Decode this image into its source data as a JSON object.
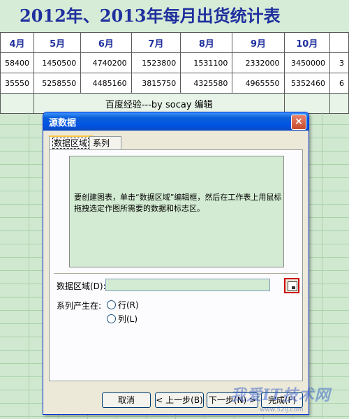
{
  "sheet": {
    "title": "2012年、2013年每月出货统计表",
    "columns": [
      "4月",
      "5月",
      "6月",
      "7月",
      "8月",
      "9月",
      "10月",
      ""
    ],
    "rows": [
      [
        "58400",
        "1450500",
        "4740200",
        "1523800",
        "1531100",
        "2332000",
        "3450000",
        "3"
      ],
      [
        "35550",
        "5258550",
        "4485160",
        "3815750",
        "4325580",
        "4965550",
        "5352460",
        "6"
      ]
    ],
    "note": "百度经验---by socay 编辑"
  },
  "dialog": {
    "title": "源数据",
    "close_label": "×",
    "tabs": [
      {
        "label": "数据区域",
        "active": true
      },
      {
        "label": "系列",
        "active": false
      }
    ],
    "preview_text": "要创建图表，单击“数据区域”编辑框，然后在工作表上用鼠标拖拽选定作图所需要的数据和标志区。",
    "data_range_label": "数据区域(D):",
    "data_range_value": "",
    "series_in_label": "系列产生在:",
    "series_options": [
      {
        "label": "行(R)"
      },
      {
        "label": "列(L)"
      }
    ],
    "buttons": {
      "cancel": "取消",
      "back": "< 上一步(B)",
      "next": "下一步(N) >",
      "finish": "完成(F)"
    }
  },
  "watermark": {
    "main": "我爱IT技术网",
    "sub": "www.52ij.com"
  }
}
